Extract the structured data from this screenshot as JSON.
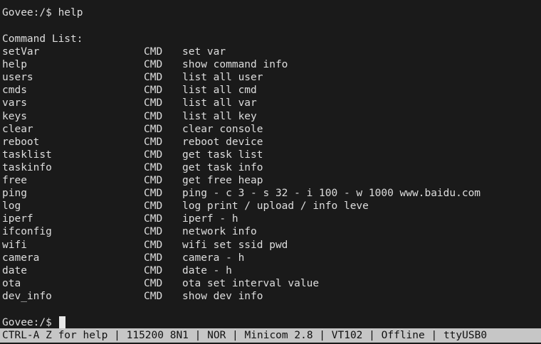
{
  "prompt_line": "Govee:/$ help",
  "list_header": "Command List:",
  "commands": [
    {
      "name": "setVar",
      "type": "CMD",
      "desc": "set var"
    },
    {
      "name": "help",
      "type": "CMD",
      "desc": "show command info"
    },
    {
      "name": "users",
      "type": "CMD",
      "desc": "list all user"
    },
    {
      "name": "cmds",
      "type": "CMD",
      "desc": "list all cmd"
    },
    {
      "name": "vars",
      "type": "CMD",
      "desc": "list all var"
    },
    {
      "name": "keys",
      "type": "CMD",
      "desc": "list all key"
    },
    {
      "name": "clear",
      "type": "CMD",
      "desc": "clear console"
    },
    {
      "name": "reboot",
      "type": "CMD",
      "desc": "reboot device"
    },
    {
      "name": "tasklist",
      "type": "CMD",
      "desc": "get task list"
    },
    {
      "name": "taskinfo",
      "type": "CMD",
      "desc": "get task info"
    },
    {
      "name": "free",
      "type": "CMD",
      "desc": "get free heap"
    },
    {
      "name": "ping",
      "type": "CMD",
      "desc": "ping - c 3 - s 32 - i 100 - w 1000 www.baidu.com"
    },
    {
      "name": "log",
      "type": "CMD",
      "desc": "log print / upload / info leve"
    },
    {
      "name": "iperf",
      "type": "CMD",
      "desc": "iperf - h"
    },
    {
      "name": "ifconfig",
      "type": "CMD",
      "desc": "network info"
    },
    {
      "name": "wifi",
      "type": "CMD",
      "desc": "wifi set ssid pwd"
    },
    {
      "name": "camera",
      "type": "CMD",
      "desc": "camera - h"
    },
    {
      "name": "date",
      "type": "CMD",
      "desc": "date - h"
    },
    {
      "name": "ota",
      "type": "CMD",
      "desc": "ota set interval value"
    },
    {
      "name": "dev_info",
      "type": "CMD",
      "desc": "show dev info"
    }
  ],
  "current_prompt": "Govee:/$ ",
  "status_bar": {
    "help_hint": "CTRL-A Z for help",
    "baud": "115200 8N1",
    "mode": "NOR",
    "program": "Minicom 2.8",
    "terminal": "VT102",
    "state": "Offline",
    "device": "ttyUSB0"
  }
}
